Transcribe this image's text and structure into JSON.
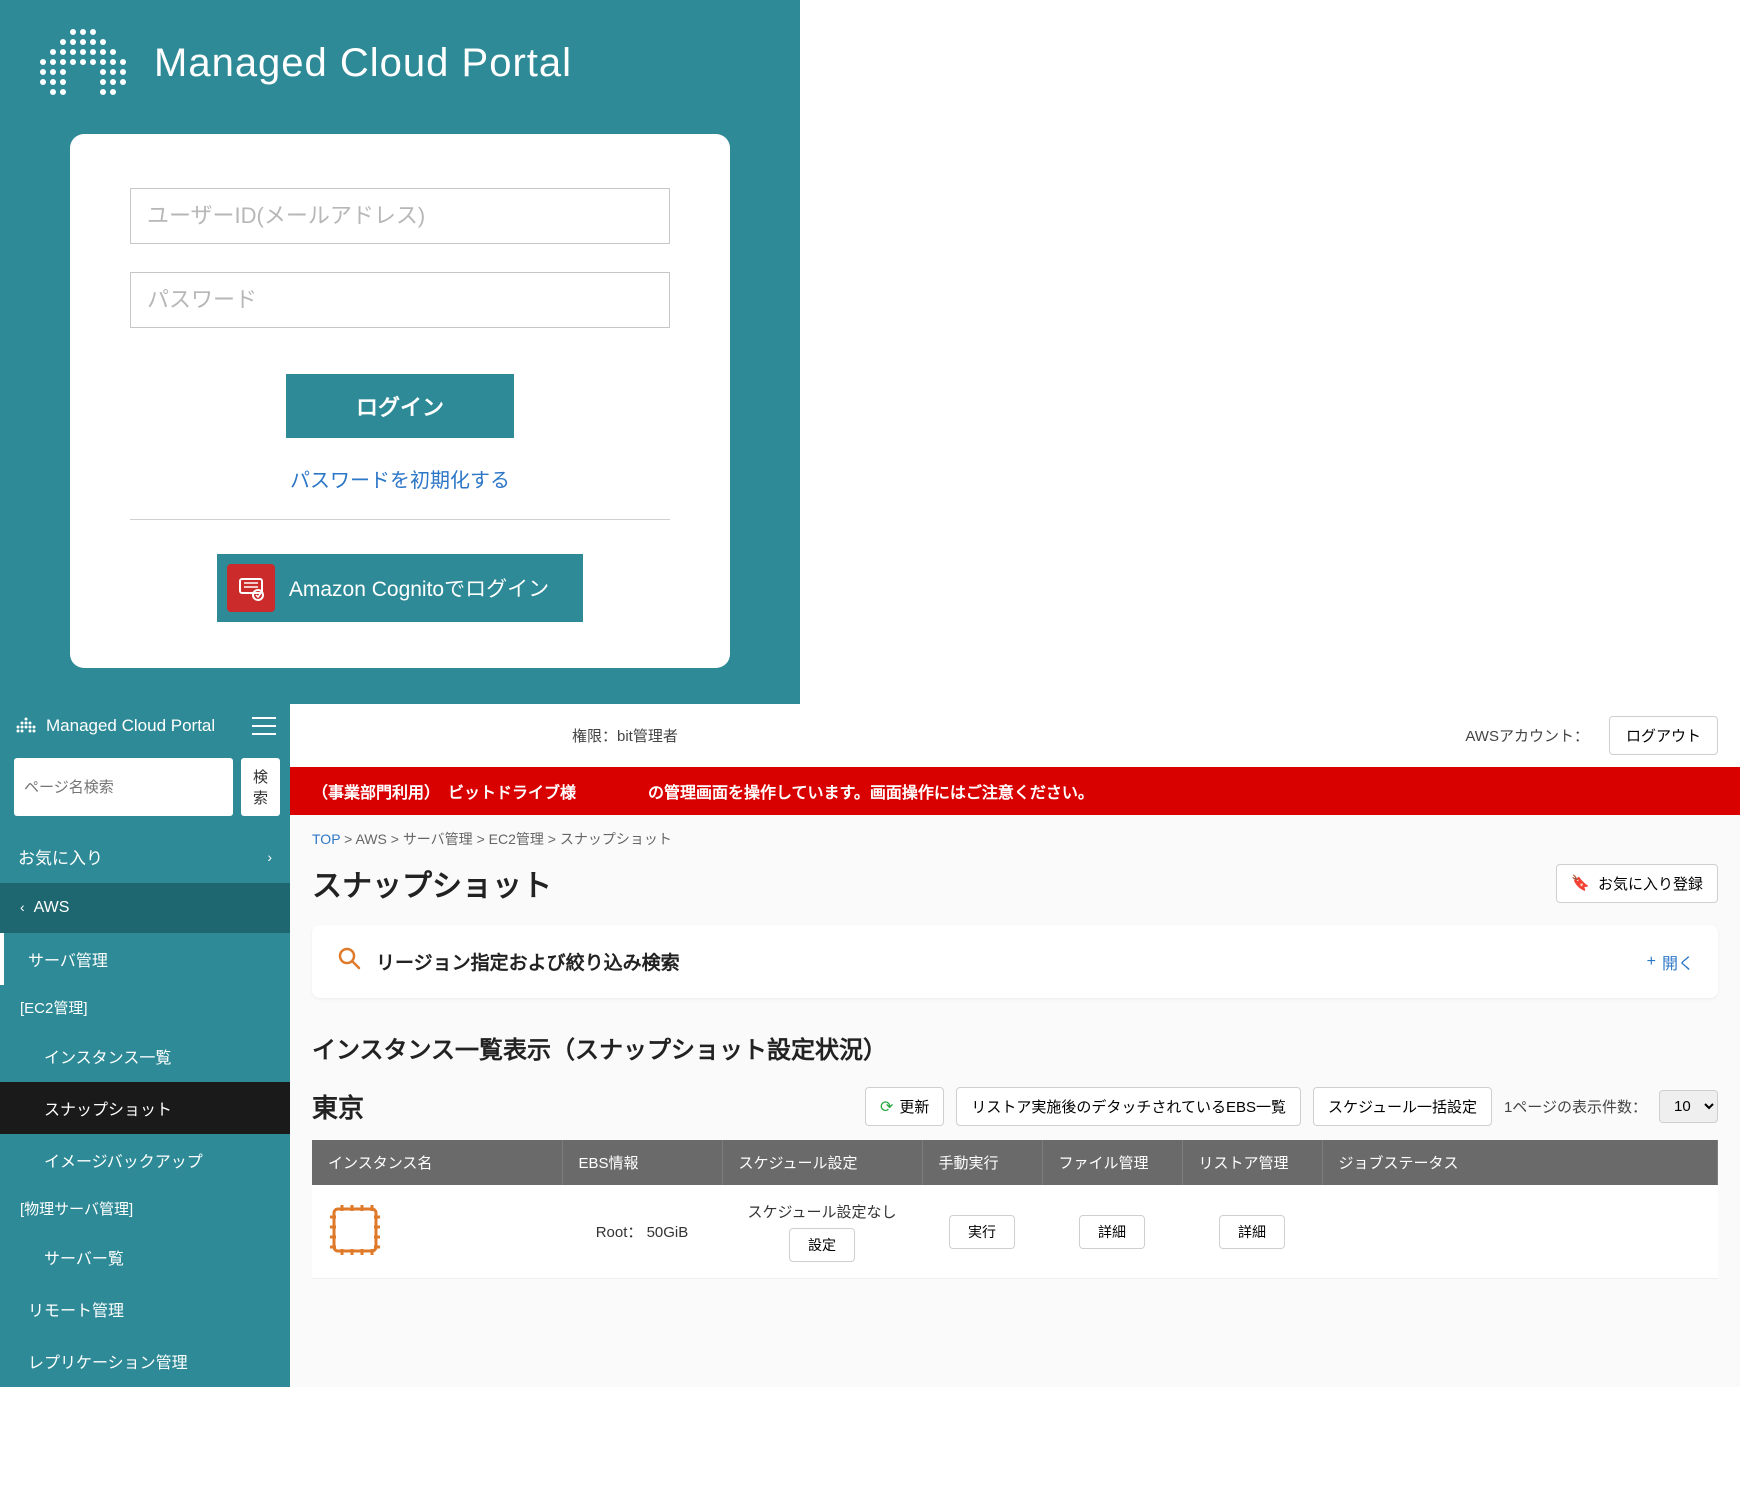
{
  "login": {
    "title": "Managed Cloud Portal",
    "user_id_placeholder": "ユーザーID(メールアドレス)",
    "password_placeholder": "パスワード",
    "login_button": "ログイン",
    "reset_link": "パスワードを初期化する",
    "cognito_button": "Amazon Cognitoでログイン"
  },
  "dashboard": {
    "brand": "Managed Cloud Portal",
    "search_placeholder": "ページ名検索",
    "search_button": "検索",
    "nav": {
      "favorites": "お気に入り",
      "aws": "AWS",
      "server_mgmt": "サーバ管理",
      "ec2_group": "[EC2管理]",
      "instance_list": "インスタンス一覧",
      "snapshot": "スナップショット",
      "image_backup": "イメージバックアップ",
      "phys_group": "[物理サーバ管理]",
      "server_list": "サーバー覧",
      "remote_mgmt": "リモート管理",
      "replication_mgmt": "レプリケーション管理"
    },
    "topbar": {
      "role_label": "権限：bit管理者",
      "account_label": "AWSアカウント：",
      "logout": "ログアウト"
    },
    "warning": {
      "prefix": "（事業部門利用）　ビットドライブ様",
      "suffix": "の管理画面を操作しています。画面操作にはご注意ください。"
    },
    "breadcrumb": {
      "top": "TOP",
      "sep": " > ",
      "aws": "AWS",
      "server": "サーバ管理",
      "ec2": "EC2管理",
      "current": "スナップショット"
    },
    "page_title": "スナップショット",
    "fav_register": "お気に入り登録",
    "search_panel_title": "リージョン指定および絞り込み検索",
    "expand_label": "開く",
    "section_title": "インスタンス一覧表示（スナップショット設定状況）",
    "region": "東京",
    "actions": {
      "refresh": "更新",
      "detached_ebs": "リストア実施後のデタッチされているEBS一覧",
      "bulk_schedule": "スケジュール一括設定",
      "page_size_label": "1ページの表示件数：",
      "page_size_value": "10"
    },
    "table": {
      "headers": [
        "インスタンス名",
        "EBS情報",
        "スケジュール設定",
        "手動実行",
        "ファイル管理",
        "リストア管理",
        "ジョブステータス"
      ],
      "row": {
        "ebs_info": "Root： 50GiB",
        "schedule_status": "スケジュール設定なし",
        "schedule_btn": "設定",
        "exec_btn": "実行",
        "detail_btn": "詳細"
      }
    }
  }
}
